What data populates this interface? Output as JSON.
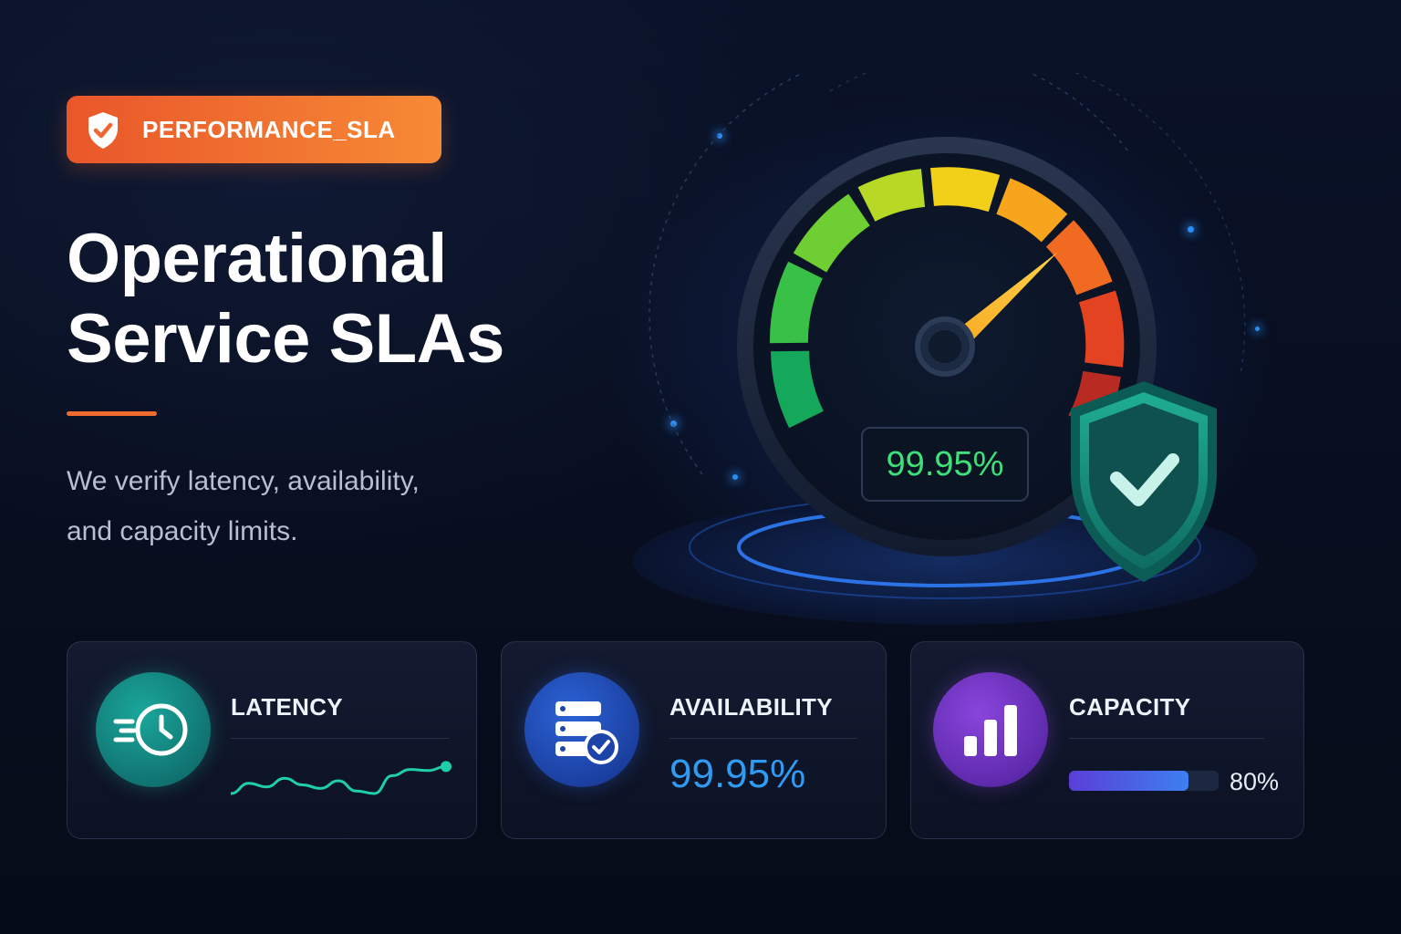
{
  "badge": {
    "label": "PERFORMANCE_SLA",
    "icon": "shield-check-icon",
    "color": "#f0692e"
  },
  "hero": {
    "title_line1": "Operational",
    "title_line2": "Service SLAs",
    "subtitle_line1": "We verify latency, availability,",
    "subtitle_line2": "and capacity limits."
  },
  "gauge": {
    "readout": "99.95%",
    "needle_level": 0.78,
    "icon": "shield-check-icon"
  },
  "cards": {
    "latency": {
      "label": "LATENCY",
      "icon": "clock-speed-icon",
      "accent": "#1fcfa5",
      "trend": [
        0.25,
        0.45,
        0.38,
        0.55,
        0.42,
        0.35,
        0.5,
        0.3,
        0.25,
        0.6,
        0.72,
        0.7,
        0.78
      ]
    },
    "availability": {
      "label": "AVAILABILITY",
      "value": "99.95%",
      "icon": "server-check-icon",
      "accent": "#2f9bf2"
    },
    "capacity": {
      "label": "CAPACITY",
      "percent_label": "80%",
      "percent": 0.8,
      "icon": "bar-chart-icon",
      "accent": "#8e4ee0"
    }
  }
}
